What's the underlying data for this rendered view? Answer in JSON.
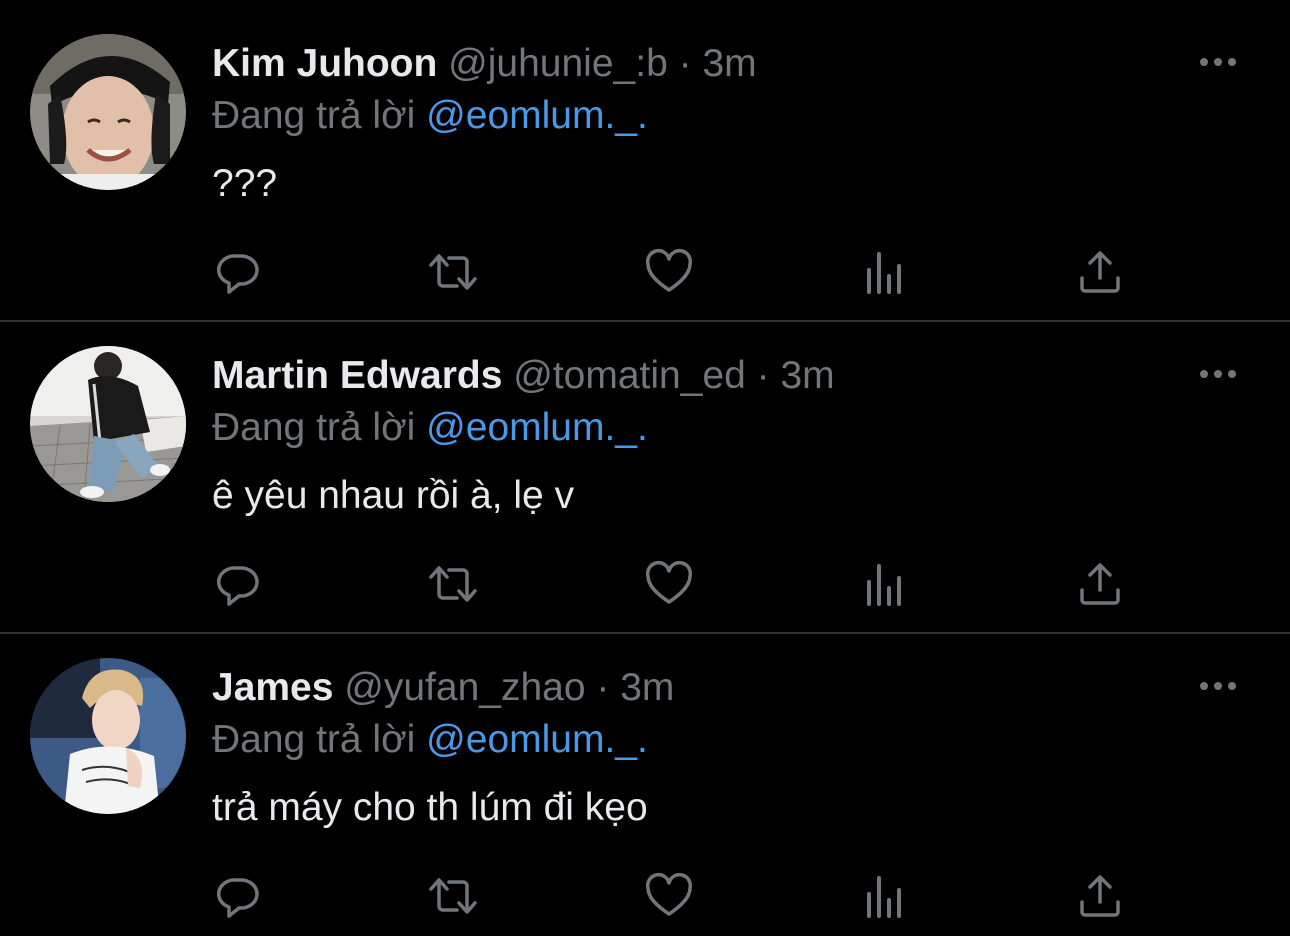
{
  "colors": {
    "background": "#000000",
    "primary_text": "#e7e9ea",
    "secondary_text": "#71767b",
    "mention": "#4a99e9",
    "divider": "#2f3336"
  },
  "tweets": [
    {
      "display_name": "Kim Juhoon",
      "handle": "@juhunie_:b",
      "separator": "·",
      "time": "3m",
      "replying_prefix": "Đang trả lời",
      "replying_to": "@eomlum._.",
      "text": "???",
      "avatar_icon": "avatar-photo"
    },
    {
      "display_name": "Martin Edwards",
      "handle": "@tomatin_ed",
      "separator": "·",
      "time": "3m",
      "replying_prefix": "Đang trả lời",
      "replying_to": "@eomlum._.",
      "text": "ê yêu nhau rồi à, lẹ v",
      "avatar_icon": "avatar-photo"
    },
    {
      "display_name": "James",
      "handle": "@yufan_zhao",
      "separator": "·",
      "time": "3m",
      "replying_prefix": "Đang trả lời",
      "replying_to": "@eomlum._.",
      "text": "trả máy cho th lúm đi kẹo",
      "avatar_icon": "avatar-photo"
    }
  ],
  "action_icons": [
    "reply-icon",
    "retweet-icon",
    "like-icon",
    "stats-icon",
    "share-icon"
  ],
  "more_icon": "more-options-icon"
}
